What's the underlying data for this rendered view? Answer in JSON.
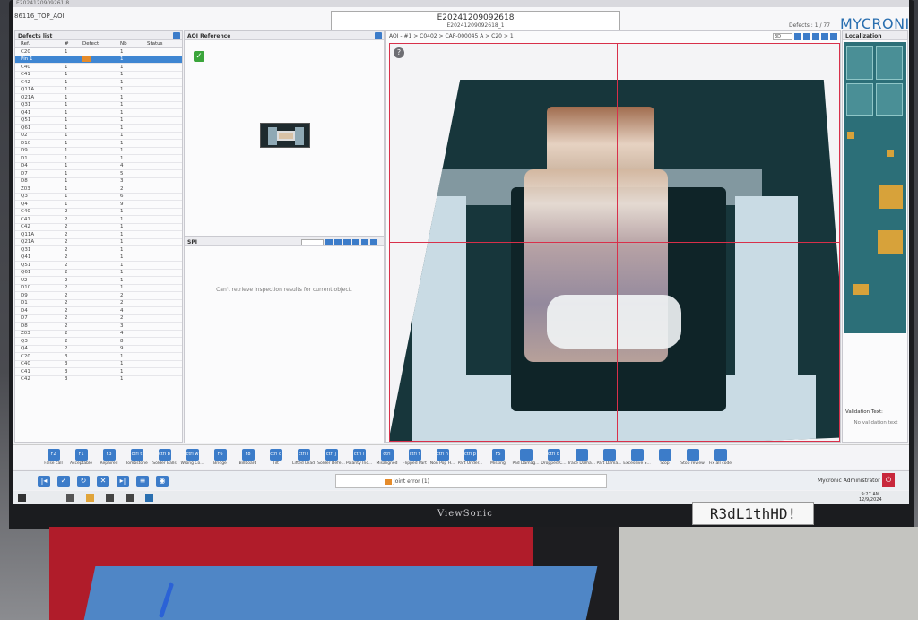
{
  "window": {
    "title": "E2024120909261 8",
    "program": "86116_TOP_AOI"
  },
  "header": {
    "board_id": "E20241209092618",
    "board_sub": "E20241209092618_1",
    "defect_count": "Defects : 1 / 77",
    "logo": "MYCRONIC"
  },
  "defects_list": {
    "title": "Defects list",
    "columns": [
      "Ref.",
      "#",
      "Defect",
      "Nb",
      "Status"
    ],
    "rows": [
      {
        "ref": "C20",
        "num": "1",
        "defect": "",
        "nb": "1",
        "status": ""
      },
      {
        "ref": "Pin 1",
        "num": "",
        "defect": "badge",
        "nb": "1",
        "status": ""
      },
      {
        "ref": "C40",
        "num": "1",
        "defect": "",
        "nb": "1",
        "status": ""
      },
      {
        "ref": "C41",
        "num": "1",
        "defect": "",
        "nb": "1",
        "status": ""
      },
      {
        "ref": "C42",
        "num": "1",
        "defect": "",
        "nb": "1",
        "status": ""
      },
      {
        "ref": "Q11A",
        "num": "1",
        "defect": "",
        "nb": "1",
        "status": ""
      },
      {
        "ref": "Q21A",
        "num": "1",
        "defect": "",
        "nb": "1",
        "status": ""
      },
      {
        "ref": "Q31",
        "num": "1",
        "defect": "",
        "nb": "1",
        "status": ""
      },
      {
        "ref": "Q41",
        "num": "1",
        "defect": "",
        "nb": "1",
        "status": ""
      },
      {
        "ref": "Q51",
        "num": "1",
        "defect": "",
        "nb": "1",
        "status": ""
      },
      {
        "ref": "Q61",
        "num": "1",
        "defect": "",
        "nb": "1",
        "status": ""
      },
      {
        "ref": "U2",
        "num": "1",
        "defect": "",
        "nb": "1",
        "status": ""
      },
      {
        "ref": "D10",
        "num": "1",
        "defect": "",
        "nb": "1",
        "status": ""
      },
      {
        "ref": "D9",
        "num": "1",
        "defect": "",
        "nb": "1",
        "status": ""
      },
      {
        "ref": "D1",
        "num": "1",
        "defect": "",
        "nb": "1",
        "status": ""
      },
      {
        "ref": "D4",
        "num": "1",
        "defect": "",
        "nb": "4",
        "status": ""
      },
      {
        "ref": "D7",
        "num": "1",
        "defect": "",
        "nb": "5",
        "status": ""
      },
      {
        "ref": "D8",
        "num": "1",
        "defect": "",
        "nb": "3",
        "status": ""
      },
      {
        "ref": "Z03",
        "num": "1",
        "defect": "",
        "nb": "2",
        "status": ""
      },
      {
        "ref": "Q3",
        "num": "1",
        "defect": "",
        "nb": "6",
        "status": ""
      },
      {
        "ref": "Q4",
        "num": "1",
        "defect": "",
        "nb": "9",
        "status": ""
      },
      {
        "ref": "C40",
        "num": "2",
        "defect": "",
        "nb": "1",
        "status": ""
      },
      {
        "ref": "C41",
        "num": "2",
        "defect": "",
        "nb": "1",
        "status": ""
      },
      {
        "ref": "C42",
        "num": "2",
        "defect": "",
        "nb": "1",
        "status": ""
      },
      {
        "ref": "Q11A",
        "num": "2",
        "defect": "",
        "nb": "1",
        "status": ""
      },
      {
        "ref": "Q21A",
        "num": "2",
        "defect": "",
        "nb": "1",
        "status": ""
      },
      {
        "ref": "Q31",
        "num": "2",
        "defect": "",
        "nb": "1",
        "status": ""
      },
      {
        "ref": "Q41",
        "num": "2",
        "defect": "",
        "nb": "1",
        "status": ""
      },
      {
        "ref": "Q51",
        "num": "2",
        "defect": "",
        "nb": "1",
        "status": ""
      },
      {
        "ref": "Q61",
        "num": "2",
        "defect": "",
        "nb": "1",
        "status": ""
      },
      {
        "ref": "U2",
        "num": "2",
        "defect": "",
        "nb": "1",
        "status": ""
      },
      {
        "ref": "D10",
        "num": "2",
        "defect": "",
        "nb": "1",
        "status": ""
      },
      {
        "ref": "D9",
        "num": "2",
        "defect": "",
        "nb": "2",
        "status": ""
      },
      {
        "ref": "D1",
        "num": "2",
        "defect": "",
        "nb": "2",
        "status": ""
      },
      {
        "ref": "D4",
        "num": "2",
        "defect": "",
        "nb": "4",
        "status": ""
      },
      {
        "ref": "D7",
        "num": "2",
        "defect": "",
        "nb": "2",
        "status": ""
      },
      {
        "ref": "D8",
        "num": "2",
        "defect": "",
        "nb": "3",
        "status": ""
      },
      {
        "ref": "Z03",
        "num": "2",
        "defect": "",
        "nb": "4",
        "status": ""
      },
      {
        "ref": "Q3",
        "num": "2",
        "defect": "",
        "nb": "8",
        "status": ""
      },
      {
        "ref": "Q4",
        "num": "2",
        "defect": "",
        "nb": "9",
        "status": ""
      },
      {
        "ref": "C20",
        "num": "3",
        "defect": "",
        "nb": "1",
        "status": ""
      },
      {
        "ref": "C40",
        "num": "3",
        "defect": "",
        "nb": "1",
        "status": ""
      },
      {
        "ref": "C41",
        "num": "3",
        "defect": "",
        "nb": "1",
        "status": ""
      },
      {
        "ref": "C42",
        "num": "3",
        "defect": "",
        "nb": "1",
        "status": ""
      }
    ],
    "selected_index": 1
  },
  "aoi_reference": {
    "title": "AOI Reference"
  },
  "spi": {
    "title": "SPI",
    "message": "Can't retrieve inspection results for current object."
  },
  "viewer": {
    "breadcrumb": "AOI - #1 > C0402 > CAP-000045 A > C20 > 1",
    "zoom": "3D"
  },
  "localization": {
    "title": "Localization",
    "validation_title": "Validation Text:",
    "validation_text": "No validation text"
  },
  "function_keys": [
    {
      "key": "F2",
      "label": "False call"
    },
    {
      "key": "F1",
      "label": "Acceptable"
    },
    {
      "key": "F3",
      "label": "Repaired"
    },
    {
      "key": "ctrl t",
      "label": "Tombstone"
    },
    {
      "key": "ctrl b",
      "label": "Solder Balls"
    },
    {
      "key": "ctrl w",
      "label": "Wrong Co..."
    },
    {
      "key": "F6",
      "label": "Bridge"
    },
    {
      "key": "F8",
      "label": "Billboard"
    },
    {
      "key": "ctrl c",
      "label": "Tilt"
    },
    {
      "key": "ctrl l",
      "label": "Lifted Lead"
    },
    {
      "key": "ctrl j",
      "label": "Solder Defe..."
    },
    {
      "key": "ctrl i",
      "label": "Polarity Inc..."
    },
    {
      "key": "ctrl m",
      "label": "Misaligned"
    },
    {
      "key": "ctrl f",
      "label": "Flipped Part"
    },
    {
      "key": "ctrl n",
      "label": "Non Pop H..."
    },
    {
      "key": "ctrl p",
      "label": "Part Under..."
    },
    {
      "key": "F5",
      "label": "Missing"
    },
    {
      "key": "",
      "label": "Pad Damag..."
    },
    {
      "key": "ctrl d",
      "label": "Dropped C..."
    },
    {
      "key": "",
      "label": "Trace Dama..."
    },
    {
      "key": "",
      "label": "Part Dama..."
    },
    {
      "key": "",
      "label": "Excessive S..."
    },
    {
      "key": "",
      "label": "Stop"
    },
    {
      "key": "",
      "label": "Stop review"
    },
    {
      "key": "",
      "label": "Fix all code"
    }
  ],
  "action_bar": {
    "joint_status": "Joint error (1)",
    "user": "Mycronic Administrator"
  },
  "taskbar": {
    "time": "9:27 AM",
    "date": "12/9/2024"
  },
  "monitor": {
    "brand": "ViewSonic",
    "asset_label": "R3dL1thHD!"
  }
}
